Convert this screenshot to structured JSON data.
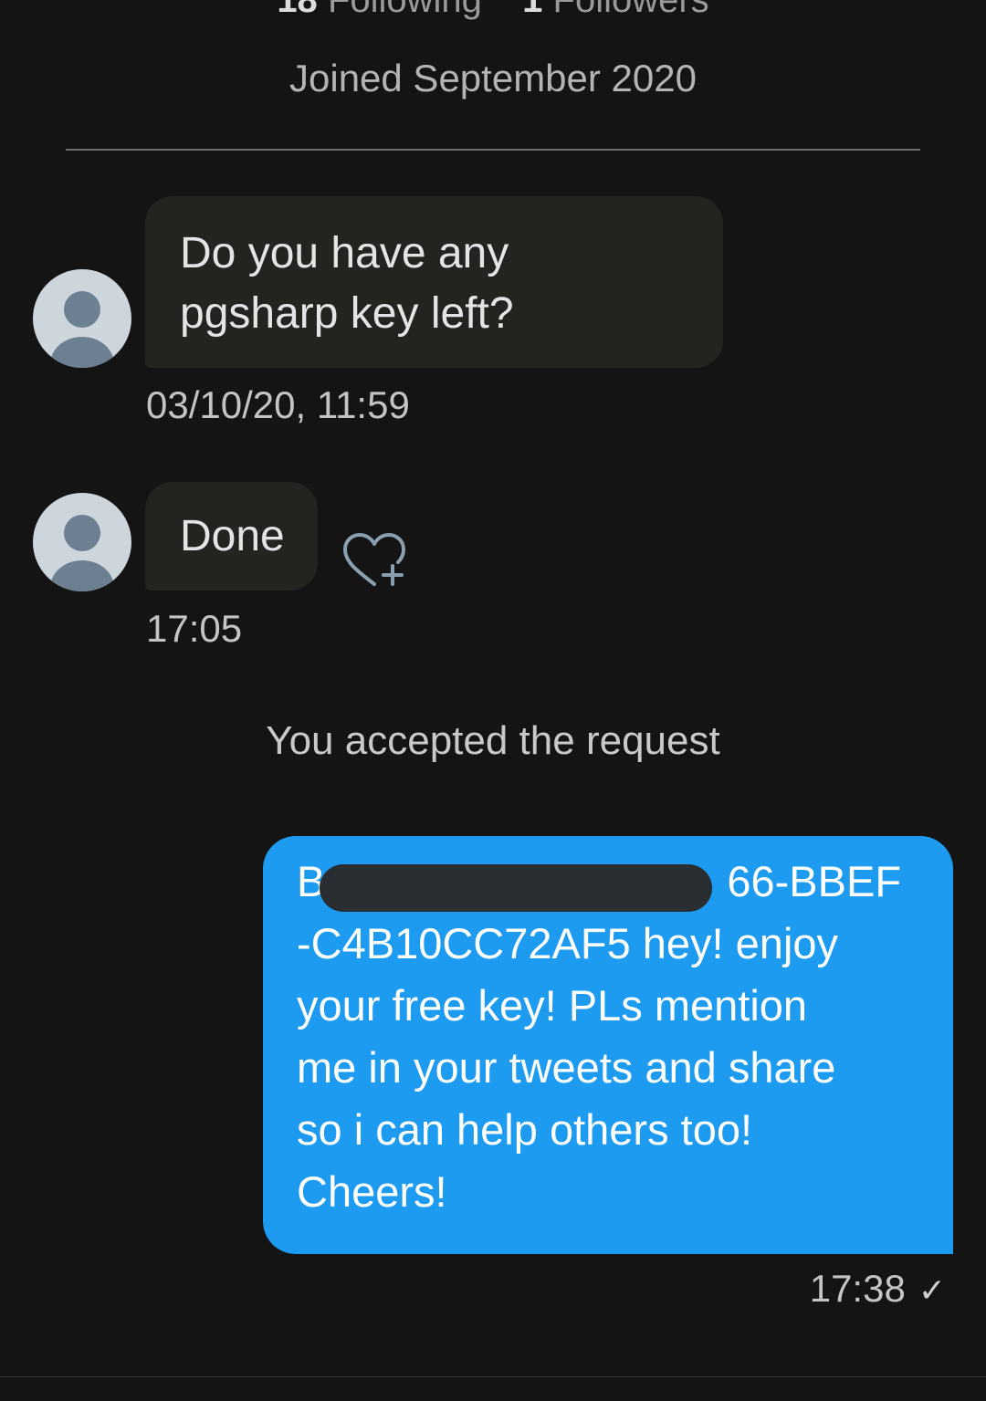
{
  "profile": {
    "following_count": "18",
    "following_label": "Following",
    "followers_count": "1",
    "followers_label": "Followers",
    "joined": "Joined September 2020"
  },
  "messages": [
    {
      "direction": "incoming",
      "lines": [
        "Do you have any",
        "pgsharp key left?"
      ],
      "time": "03/10/20, 11:59"
    },
    {
      "direction": "incoming",
      "text": "Done",
      "time": "17:05",
      "reaction_icon": "heart-plus-icon"
    }
  ],
  "system_message": "You accepted the request",
  "outgoing": {
    "lines": [
      "B",
      "66-BBEF",
      "-C4B10CC72AF5 hey! enjoy",
      "your free key! PLs mention",
      "me in your tweets and share",
      "so i can help others too!",
      "Cheers!"
    ],
    "time": "17:38",
    "status_icon": "✓"
  },
  "colors": {
    "background": "#141414",
    "incoming_bubble": "#252320",
    "outgoing_bubble": "#1d9bf0",
    "redaction": "#2a2d31"
  }
}
